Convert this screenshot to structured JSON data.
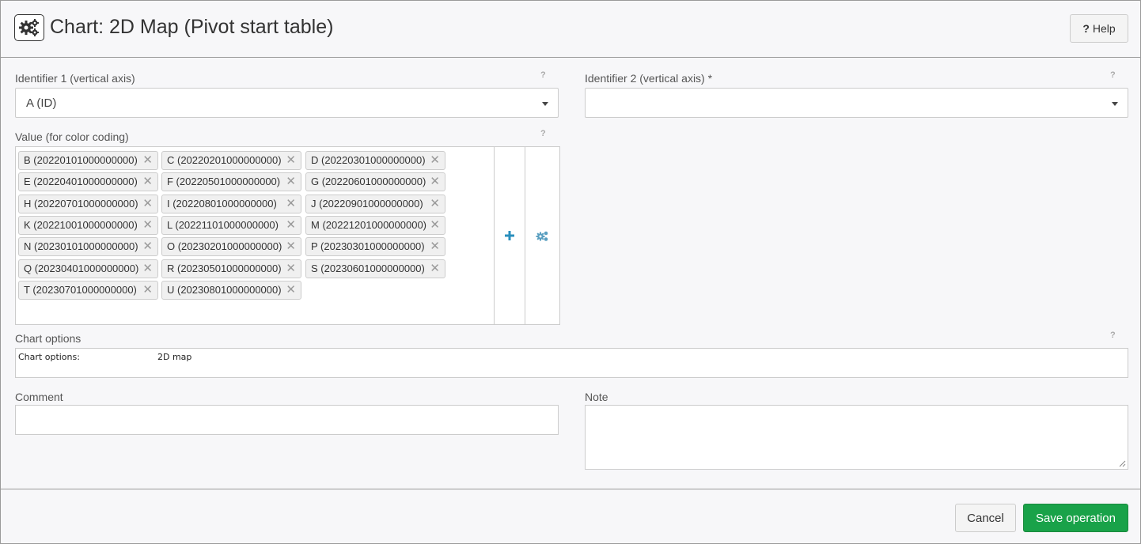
{
  "header": {
    "title": "Chart: 2D Map (Pivot start table)",
    "icon": "gears-icon",
    "help_label": "Help",
    "help_mark": "?"
  },
  "form": {
    "identifier1": {
      "label": "Identifier 1 (vertical axis)",
      "value": "A (ID)",
      "help": "?"
    },
    "identifier2": {
      "label": "Identifier 2 (vertical axis) *",
      "value": "",
      "help": "?"
    },
    "value": {
      "label": "Value (for color coding)",
      "help": "?",
      "tags": [
        "B (20220101000000000)",
        "C (20220201000000000)",
        "D (20220301000000000)",
        "E (20220401000000000)",
        "F (20220501000000000)",
        "G (20220601000000000)",
        "H (20220701000000000)",
        "I (20220801000000000)",
        "J (20220901000000000)",
        "K (20221001000000000)",
        "L (20221101000000000)",
        "M (20221201000000000)",
        "N (20230101000000000)",
        "O (20230201000000000)",
        "P (20230301000000000)",
        "Q (20230401000000000)",
        "R (20230501000000000)",
        "S (20230601000000000)",
        "T (20230701000000000)",
        "U (20230801000000000)"
      ],
      "remove_glyph": "✕"
    },
    "chart_options": {
      "label": "Chart options",
      "help": "?",
      "key": "Chart options:",
      "value": "2D map"
    },
    "comment": {
      "label": "Comment",
      "value": ""
    },
    "note": {
      "label": "Note",
      "value": ""
    }
  },
  "footer": {
    "cancel_label": "Cancel",
    "save_label": "Save operation"
  },
  "colors": {
    "save": "#19a249",
    "accent_plus": "#2a8fbd",
    "accent_gears": "#5a9fc0"
  }
}
